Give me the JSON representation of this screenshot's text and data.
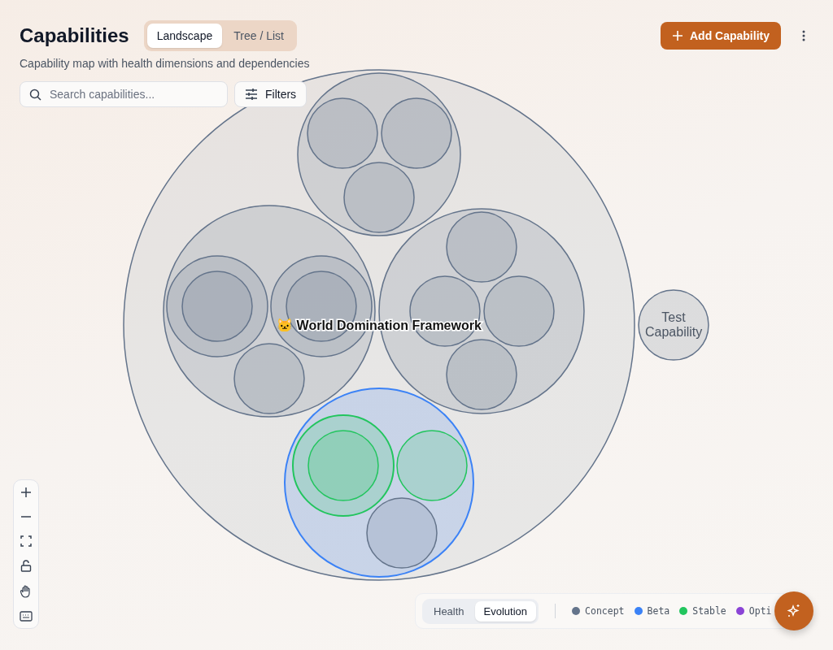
{
  "header": {
    "title": "Capabilities",
    "subtitle": "Capability map with health dimensions and dependencies",
    "add_button": "Add Capability"
  },
  "view_tabs": [
    {
      "label": "Landscape",
      "selected": true
    },
    {
      "label": "Tree / List",
      "selected": false
    }
  ],
  "search": {
    "placeholder": "Search capabilities..."
  },
  "filters_button": "Filters",
  "map": {
    "nodes": [
      {
        "name": "🐱 World Domination Framework",
        "color": "#64748b",
        "children": [
          {
            "color": "#64748b",
            "children": [
              {
                "color": "#64748b"
              },
              {
                "color": "#64748b"
              },
              {
                "color": "#64748b"
              }
            ]
          },
          {
            "color": "#64748b",
            "children": [
              {
                "color": "#64748b",
                "children": [
                  {
                    "color": "#64748b"
                  }
                ]
              },
              {
                "color": "#64748b",
                "children": [
                  {
                    "color": "#64748b"
                  }
                ]
              },
              {
                "color": "#64748b"
              }
            ]
          },
          {
            "color": "#64748b",
            "children": [
              {
                "color": "#64748b"
              },
              {
                "color": "#64748b"
              },
              {
                "color": "#64748b"
              },
              {
                "color": "#64748b"
              }
            ]
          },
          {
            "color": "#3b82f6",
            "children": [
              {
                "color": "#22c55e",
                "children": [
                  {
                    "color": "#22c55e"
                  }
                ]
              },
              {
                "color": "#22c55e"
              },
              {
                "color": "#64748b"
              }
            ]
          }
        ]
      },
      {
        "name": "Test Capability",
        "color": "#64748b"
      }
    ]
  },
  "mode_tabs": [
    {
      "label": "Health",
      "selected": false
    },
    {
      "label": "Evolution",
      "selected": true
    }
  ],
  "legend": [
    {
      "label": "Concept",
      "color": "#64748b"
    },
    {
      "label": "Beta",
      "color": "#3b82f6"
    },
    {
      "label": "Stable",
      "color": "#22c55e"
    },
    {
      "label": "Opti",
      "color": "#8b44d6"
    }
  ]
}
